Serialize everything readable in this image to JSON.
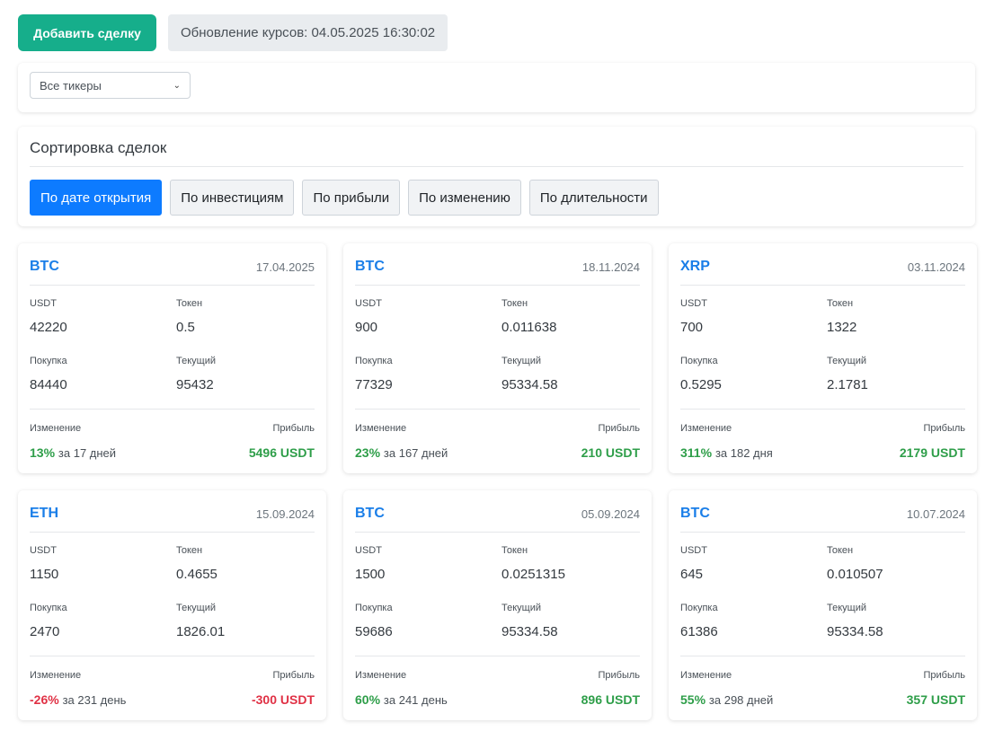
{
  "toolbar": {
    "add_button": "Добавить сделку",
    "rates_update": "Обновление курсов: 04.05.2025 16:30:02"
  },
  "filter": {
    "ticker_select": "Все тикеры"
  },
  "sort": {
    "title": "Сортировка сделок",
    "buttons": [
      "По дате открытия",
      "По инвестициям",
      "По прибыли",
      "По изменению",
      "По длительности"
    ],
    "active": "По дате открытия"
  },
  "labels": {
    "usdt": "USDT",
    "token": "Токен",
    "buy": "Покупка",
    "current": "Текущий",
    "change": "Изменение",
    "profit": "Прибыль"
  },
  "colors": {
    "positive": "#2e9e49",
    "negative": "#e03145",
    "accent": "#0d7bff",
    "add_button": "#16ae8b"
  },
  "deals": [
    {
      "ticker": "BTC",
      "date": "17.04.2025",
      "usdt": "42220",
      "token": "0.5",
      "buy": "84440",
      "current": "95432",
      "change": "13%",
      "duration": "за 17 дней",
      "profit": "5496 USDT",
      "positive": true
    },
    {
      "ticker": "BTC",
      "date": "18.11.2024",
      "usdt": "900",
      "token": "0.011638",
      "buy": "77329",
      "current": "95334.58",
      "change": "23%",
      "duration": "за 167 дней",
      "profit": "210 USDT",
      "positive": true
    },
    {
      "ticker": "XRP",
      "date": "03.11.2024",
      "usdt": "700",
      "token": "1322",
      "buy": "0.5295",
      "current": "2.1781",
      "change": "311%",
      "duration": "за 182 дня",
      "profit": "2179 USDT",
      "positive": true
    },
    {
      "ticker": "ETH",
      "date": "15.09.2024",
      "usdt": "1150",
      "token": "0.4655",
      "buy": "2470",
      "current": "1826.01",
      "change": "-26%",
      "duration": "за 231 день",
      "profit": "-300 USDT",
      "positive": false
    },
    {
      "ticker": "BTC",
      "date": "05.09.2024",
      "usdt": "1500",
      "token": "0.0251315",
      "buy": "59686",
      "current": "95334.58",
      "change": "60%",
      "duration": "за 241 день",
      "profit": "896 USDT",
      "positive": true
    },
    {
      "ticker": "BTC",
      "date": "10.07.2024",
      "usdt": "645",
      "token": "0.010507",
      "buy": "61386",
      "current": "95334.58",
      "change": "55%",
      "duration": "за 298 дней",
      "profit": "357 USDT",
      "positive": true
    }
  ]
}
